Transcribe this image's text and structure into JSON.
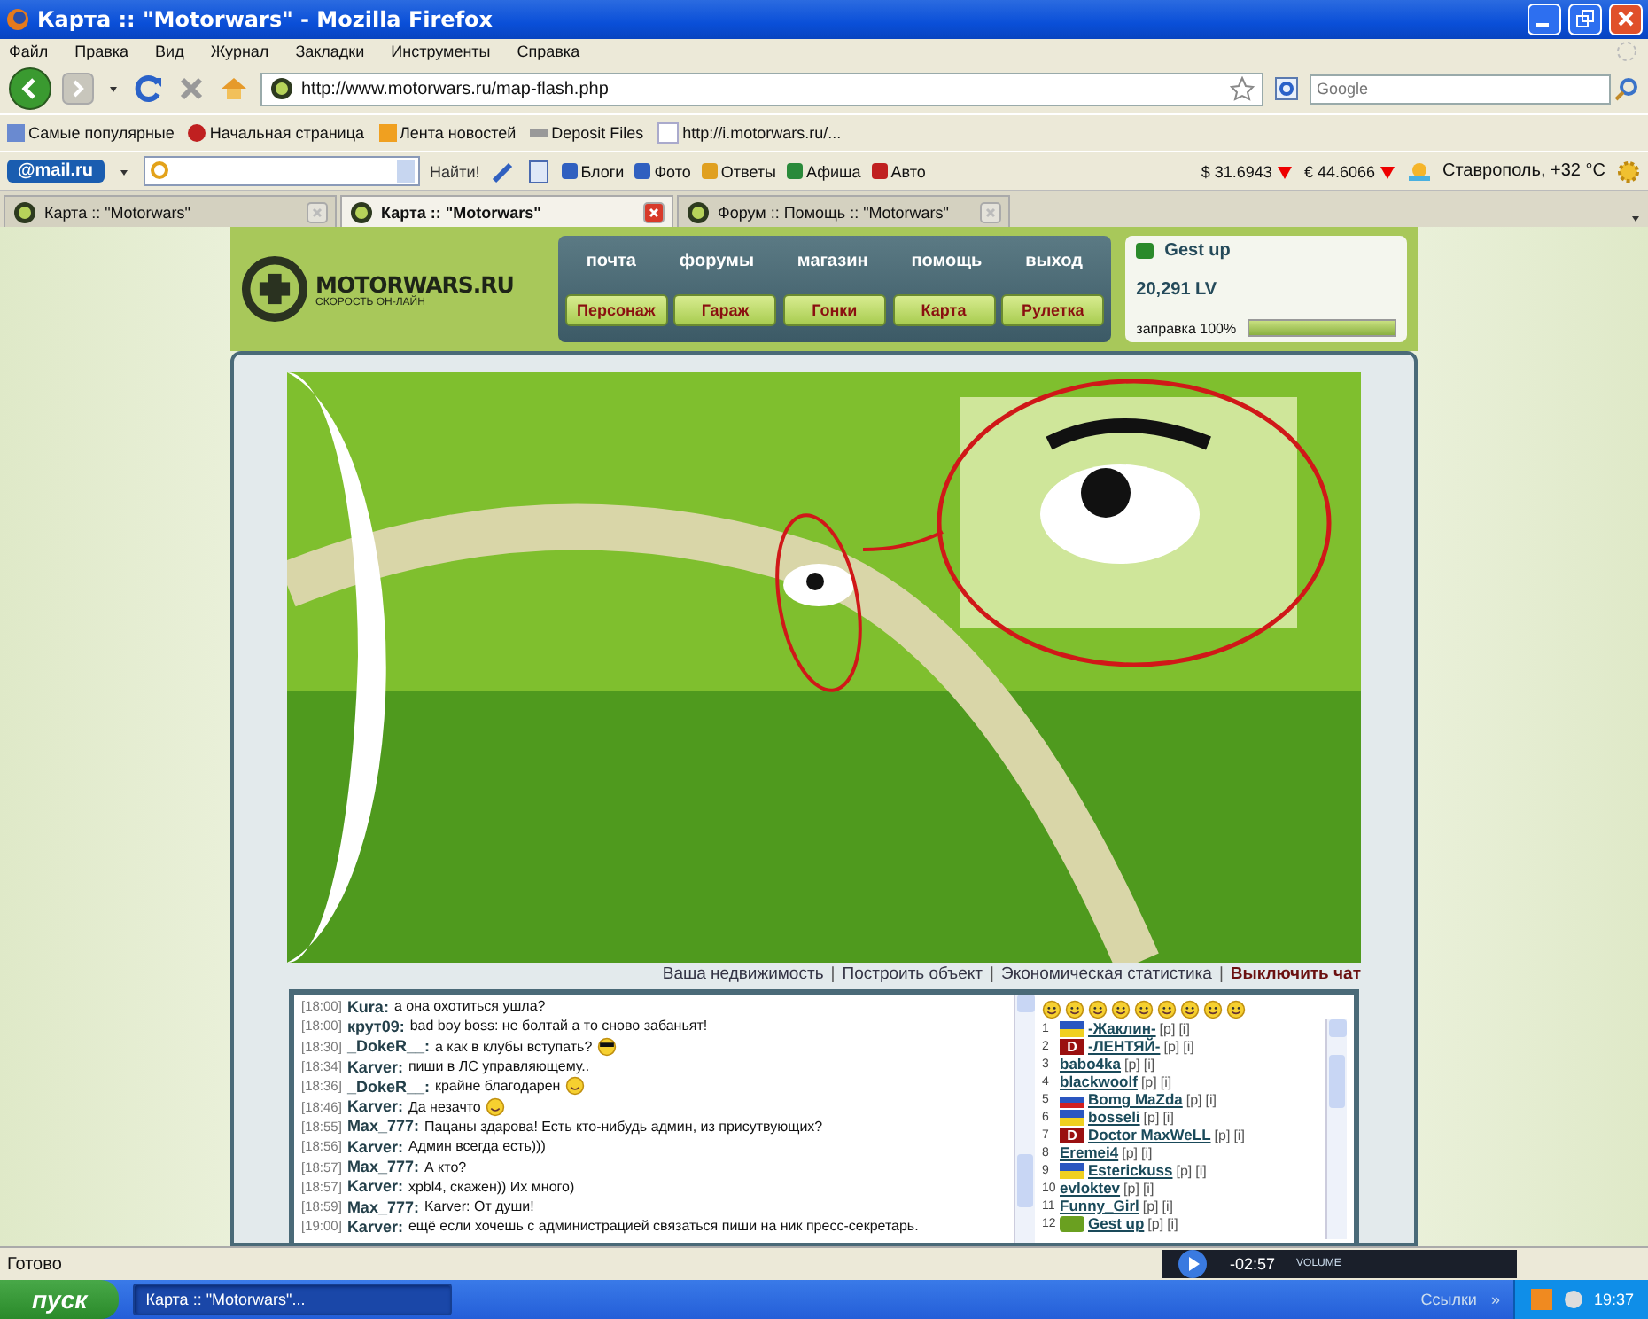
{
  "window": {
    "title": "Карта :: \"Motorwars\" - Mozilla Firefox"
  },
  "menu": [
    "Файл",
    "Правка",
    "Вид",
    "Журнал",
    "Закладки",
    "Инструменты",
    "Справка"
  ],
  "address": {
    "url": "http://www.motorwars.ru/map-flash.php"
  },
  "search": {
    "placeholder": "Google"
  },
  "bookmarks": [
    {
      "kind": "popular",
      "label": "Самые популярные"
    },
    {
      "kind": "home",
      "label": "Начальная страница"
    },
    {
      "kind": "feed",
      "label": "Лента новостей"
    },
    {
      "kind": "deposit",
      "label": "Deposit Files"
    },
    {
      "kind": "page",
      "label": "http://i.motorwars.ru/..."
    }
  ],
  "mailbar": {
    "logo": "@mail.ru",
    "find": "Найти!",
    "links": [
      {
        "kind": "blog",
        "label": "Блоги"
      },
      {
        "kind": "photo",
        "label": "Фото"
      },
      {
        "kind": "answers",
        "label": "Ответы"
      },
      {
        "kind": "poster",
        "label": "Афиша"
      },
      {
        "kind": "car",
        "label": "Авто"
      }
    ],
    "rates": [
      {
        "label": "$ 31.6943",
        "falling": true
      },
      {
        "label": "€ 44.6066",
        "falling": true
      }
    ],
    "weather": "Ставрополь, +32 °C"
  },
  "tabs": [
    {
      "label": "Карта :: \"Motorwars\"",
      "selected": false
    },
    {
      "label": "Карта :: \"Motorwars\"",
      "selected": true
    },
    {
      "label": "Форум :: Помощь :: \"Motorwars\"",
      "selected": false
    }
  ],
  "site": {
    "logo": "MOTORWARS.RU",
    "tagline": "СКОРОСТЬ ОН-ЛАЙН",
    "top_links": [
      "почта",
      "форумы",
      "магазин",
      "помощь",
      "выход"
    ],
    "buttons": [
      "Персонаж",
      "Гараж",
      "Гонки",
      "Карта",
      "Рулетка"
    ],
    "user": {
      "name": "Gest up",
      "balance": "20,291 LV",
      "fuel_label": "заправка 100%",
      "level": 1.0
    },
    "map_links": [
      {
        "label": "Ваша недвижимость",
        "bold": false
      },
      {
        "separator": "|",
        "label": "Построить объект",
        "bold": false
      },
      {
        "separator": "|",
        "label": "Экономическая статистика",
        "bold": false
      },
      {
        "separator": "|",
        "label": "Выключить чат",
        "bold": true
      }
    ],
    "chat": [
      {
        "time": "[18:00]",
        "nick": "Kura:",
        "text": "а она охотиться ушла?"
      },
      {
        "time": "[18:00]",
        "nick": "крут09:",
        "text": "bad boy boss: не болтай а то сново забаньят!"
      },
      {
        "time": "[18:30]",
        "nick": "_DokeR__:",
        "text": "а как в клубы вступать?",
        "kind": "cool"
      },
      {
        "time": "[18:34]",
        "nick": "Karver:",
        "text": "пиши в ЛС управляющему.."
      },
      {
        "time": "[18:36]",
        "nick": "_DokeR__:",
        "text": "крайне благодарен",
        "kind": "smile"
      },
      {
        "time": "[18:46]",
        "nick": "Karver:",
        "text": "Да незачто",
        "kind": "smile"
      },
      {
        "time": "[18:55]",
        "nick": "Max_777:",
        "text": "Пацаны здарова! Есть кто-нибудь админ, из присутвующих?"
      },
      {
        "time": "[18:56]",
        "nick": "Karver:",
        "text": "Админ всегда есть)))"
      },
      {
        "time": "[18:57]",
        "nick": "Max_777:",
        "text": "А кто?"
      },
      {
        "time": "[18:57]",
        "nick": "Karver:",
        "text": "xpbl4, скажен)) Их много)"
      },
      {
        "time": "[18:59]",
        "nick": "Max_777:",
        "text": "Karver: От души!"
      },
      {
        "time": "[19:00]",
        "nick": "Karver:",
        "text": "ещё если хочешь с администрацией связаться пиши на ник пресс-секретарь."
      }
    ],
    "users": [
      {
        "num": "1",
        "kind": "flag2",
        "name": "-Жаклин-",
        "actions": [
          "[p]",
          "[i]"
        ]
      },
      {
        "num": "2",
        "kind": "letter",
        "letter": "D",
        "name": "-ЛЕНТЯЙ-",
        "actions": [
          "[p]",
          "[i]"
        ]
      },
      {
        "num": "3",
        "name": "babo4ka",
        "actions": [
          "[p]",
          "[i]"
        ]
      },
      {
        "num": "4",
        "name": "blackwoolf",
        "actions": [
          "[p]",
          "[i]"
        ]
      },
      {
        "num": "5",
        "kind": "flag3",
        "name": "Bomg MaZda",
        "actions": [
          "[p]",
          "[i]"
        ]
      },
      {
        "num": "6",
        "kind": "flag2",
        "name": "bosseli",
        "actions": [
          "[p]",
          "[i]"
        ]
      },
      {
        "num": "7",
        "kind": "letter",
        "letter": "D",
        "name": "Doctor MaxWeLL",
        "actions": [
          "[p]",
          "[i]"
        ]
      },
      {
        "num": "8",
        "name": "Eremei4",
        "actions": [
          "[p]",
          "[i]"
        ]
      },
      {
        "num": "9",
        "kind": "flag2",
        "name": "Esterickuss",
        "actions": [
          "[p]",
          "[i]"
        ]
      },
      {
        "num": "10",
        "name": "evloktev",
        "actions": [
          "[p]",
          "[i]"
        ]
      },
      {
        "num": "11",
        "name": "Funny_Girl",
        "actions": [
          "[p]",
          "[i]"
        ]
      },
      {
        "num": "12",
        "kind": "dot",
        "name": "Gest up",
        "actions": [
          "[p]",
          "[i]"
        ]
      }
    ]
  },
  "status_bar": "Готово",
  "player": {
    "time": "-02:57",
    "volume_label": "VOLUME"
  },
  "taskbar": {
    "start": "пуск",
    "tasks": [
      {
        "label": "Карта :: \"Motorwars\"...",
        "selected": true
      }
    ],
    "links": "Ссылки",
    "chevron": "»",
    "clock": "19:37"
  }
}
